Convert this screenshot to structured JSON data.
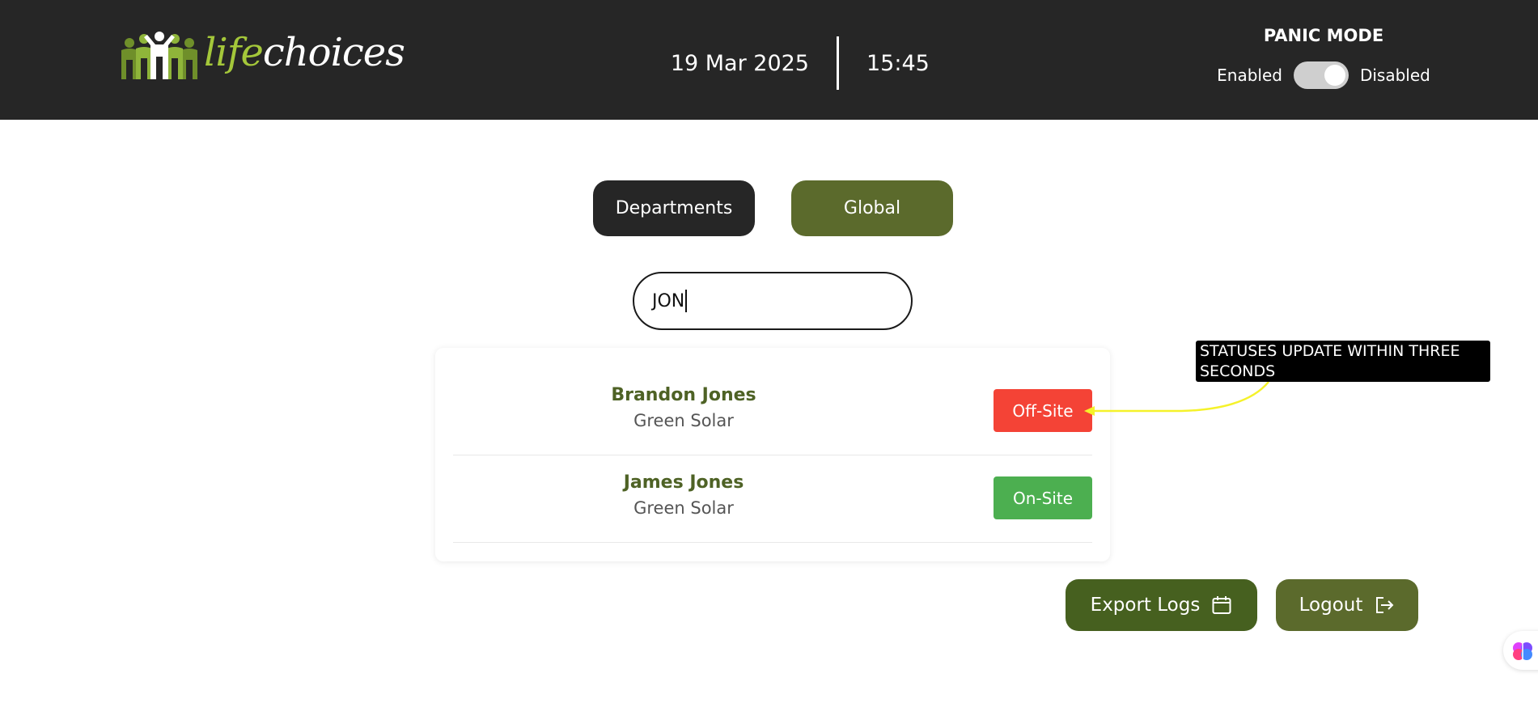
{
  "header": {
    "logo_life": "life",
    "logo_choices": "choices",
    "date": "19 Mar 2025",
    "time": "15:45"
  },
  "panic_mode": {
    "title": "PANIC MODE",
    "enabled_label": "Enabled",
    "disabled_label": "Disabled",
    "state": "Disabled"
  },
  "tabs": {
    "departments": "Departments",
    "global": "Global"
  },
  "search": {
    "value": "JON"
  },
  "results": [
    {
      "name": "Brandon Jones",
      "department": "Green Solar",
      "status": "Off-Site",
      "status_color": "#f44336"
    },
    {
      "name": "James Jones",
      "department": "Green Solar",
      "status": "On-Site",
      "status_color": "#4caf50"
    }
  ],
  "annotation": {
    "text": "STATUSES UPDATE WITHIN THREE SECONDS",
    "arrow_color": "#f5f22a"
  },
  "actions": {
    "export_label": "Export Logs",
    "export_icon": "calendar-icon",
    "logout_label": "Logout",
    "logout_icon": "logout-icon"
  },
  "colors": {
    "header_bg": "#262626",
    "olive": "#5b6a2c",
    "dark_green": "#46601f",
    "name_green": "#4e6225",
    "logo_accent": "#a4c73a"
  }
}
